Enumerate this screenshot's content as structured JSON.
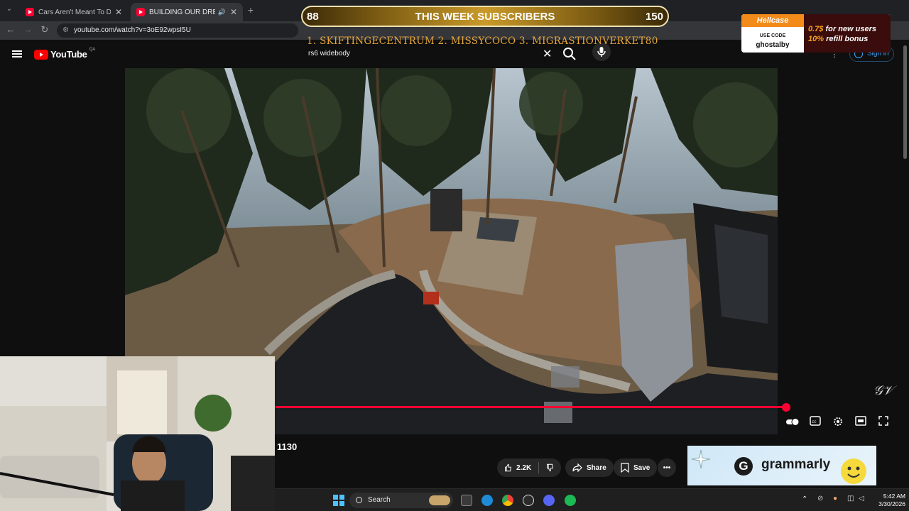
{
  "browser": {
    "tabs": [
      {
        "title": "Cars Aren't Meant To Do That -",
        "active": false
      },
      {
        "title": "BUILDING OUR DREAM GO",
        "active": true
      }
    ],
    "address": "youtube.com/watch?v=3oE92wpsI5U"
  },
  "youtube": {
    "logo_text": "YouTube",
    "logo_country": "QA",
    "search_value": "rs6 widebody",
    "sign_in": "Sign in"
  },
  "overlay": {
    "subs_left": "88",
    "subs_title": "THIS WEEK SUBSCRIBERS",
    "subs_right": "150",
    "top_list": "1. SKIFTINGECENTRUM  2. MISSYCOCO  3. MIGRASTIONVERKET80"
  },
  "sponsor": {
    "brand": "Hellcase",
    "use_code": "USE CODE",
    "code": "ghostalby",
    "line1_value": "0.7$",
    "line1_text": " for new users",
    "line2_value": "10%",
    "line2_text": " refill bonus"
  },
  "player": {
    "progress": 0.99,
    "view_count": "1130"
  },
  "actions": {
    "likes": "2.2K",
    "share": "Share",
    "save": "Save"
  },
  "ad": {
    "brand": "grammarly"
  },
  "taskbar": {
    "search": "Search",
    "time": "5:42 AM",
    "date": "3/30/2026"
  },
  "colors": {
    "accent": "#ff0033",
    "overlay_gold": "#e7a73b",
    "hellcase_orange": "#f28b1a"
  }
}
